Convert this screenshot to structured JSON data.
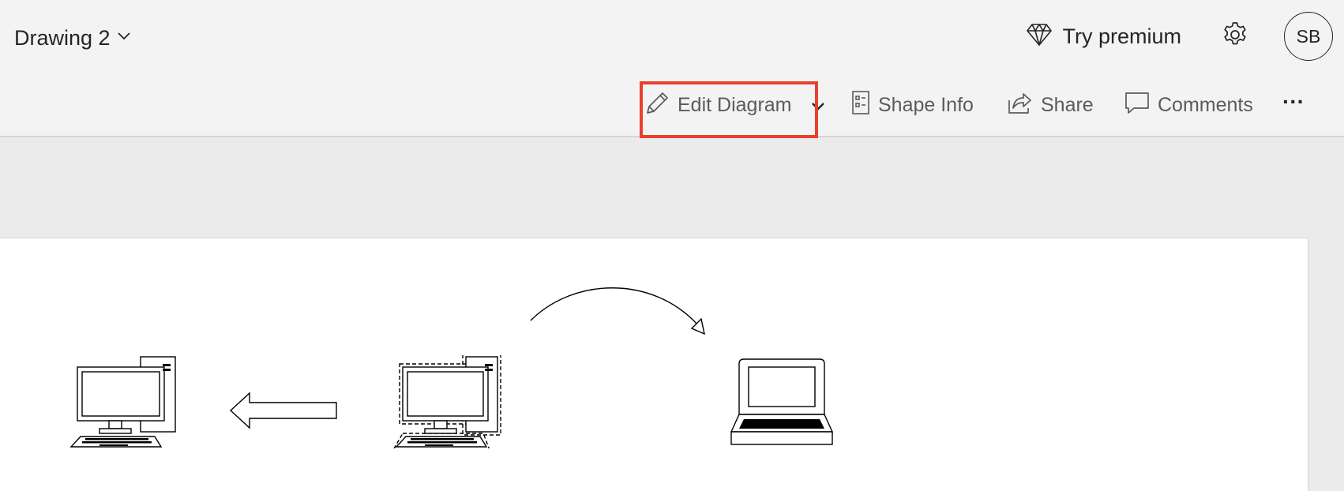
{
  "header": {
    "doc_title": "Drawing 2",
    "try_premium_label": "Try premium",
    "avatar_initials": "SB"
  },
  "toolbar": {
    "edit_diagram_label": "Edit Diagram",
    "shape_info_label": "Shape Info",
    "share_label": "Share",
    "comments_label": "Comments",
    "more_label": "···"
  },
  "colors": {
    "highlight": "#e8412c",
    "header_bg": "#f3f3f3",
    "canvas_bg": "#ffffff",
    "workspace_bg": "#ebebeb"
  },
  "icons": {
    "title_dropdown": "chevron-down-icon",
    "premium": "diamond-icon",
    "settings": "gear-icon",
    "edit": "pencil-icon",
    "edit_dropdown": "chevron-down-icon",
    "shape_info": "document-list-icon",
    "share": "share-arrow-icon",
    "comments": "speech-bubble-icon",
    "more": "ellipsis-icon"
  },
  "diagram": {
    "shapes": [
      "desktop-computer",
      "left-arrow",
      "desktop-computer-selected",
      "curved-connector",
      "laptop"
    ]
  }
}
